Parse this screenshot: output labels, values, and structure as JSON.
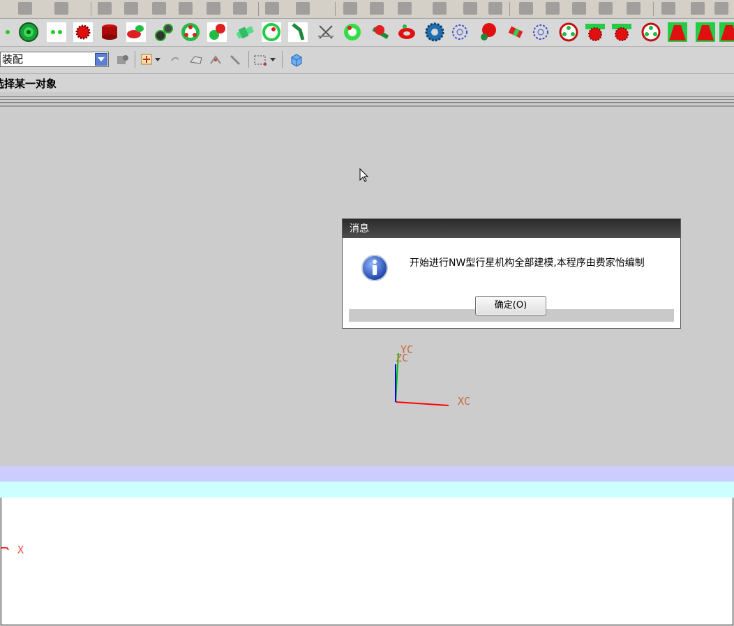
{
  "toolbar": {
    "assembly_combo_value": "装配",
    "feature_icons": [
      "small-dot-gear-icon",
      "green-ring-gear-icon",
      "double-dot-gear-icon",
      "red-spur-gear-icon",
      "red-helical-gear-icon",
      "bevel-gear-pair-icon",
      "black-gear-train-icon",
      "planetary-gear-icon",
      "red-green-gear-pair-icon",
      "green-shaft-icon",
      "green-ring-red-dot-icon",
      "bent-pipe-icon",
      "x-datum-icon",
      "green-disc-icon",
      "red-gear-on-shaft-icon",
      "red-torus-icon",
      "blue-ring-gear-icon",
      "outline-gear-icon",
      "red-cluster-gear-icon",
      "red-green-block-icon",
      "blue-outline-gear-icon",
      "spoked-wheel-icon",
      "green-red-rack-gear-icon",
      "green-red-rack-gear-2-icon",
      "spoked-wheel-2-icon",
      "red-trapezoid-icon",
      "red-trapezoid-2-icon"
    ]
  },
  "cue_line": "选择某一对象",
  "dialog": {
    "title": "消息",
    "message": "开始进行NW型行星机构全部建模,本程序由费家怡编制",
    "ok_label": "确定(O)",
    "icon": "information-icon"
  },
  "triad": {
    "xc_label": "XC",
    "yc_label": "YC",
    "zc_label": "ZC"
  },
  "bottom_axis_label": "X",
  "colors": {
    "viewport_bg": "#cccccc",
    "band_lavender": "#ccccff",
    "band_cyan": "#ccffff",
    "axis_x": "#ff0000",
    "axis_y": "#00cc00",
    "axis_z": "#0000ff"
  }
}
